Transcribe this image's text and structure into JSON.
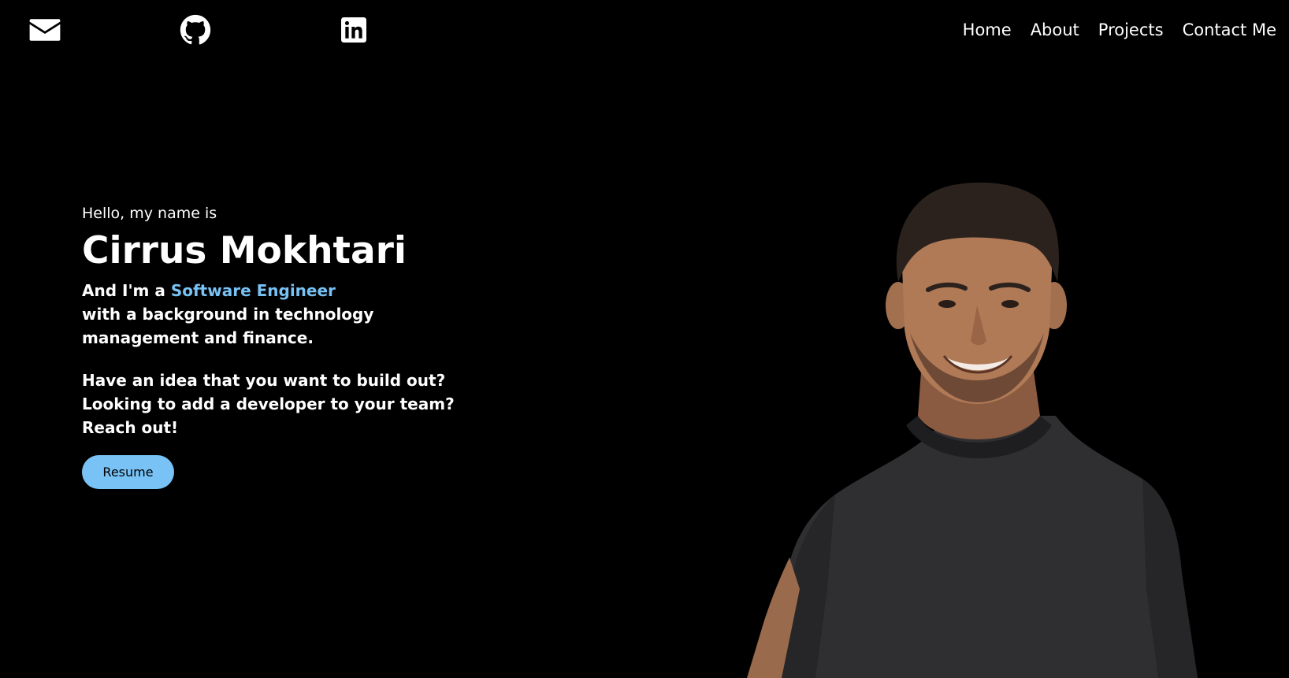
{
  "social": {
    "email_icon": "envelope-icon",
    "github_icon": "github-icon",
    "linkedin_icon": "linkedin-icon"
  },
  "nav": {
    "items": [
      {
        "label": "Home"
      },
      {
        "label": "About"
      },
      {
        "label": "Projects"
      },
      {
        "label": "Contact Me"
      }
    ]
  },
  "hero": {
    "greeting": "Hello, my name is",
    "name": "Cirrus Mokhtari",
    "role_prefix": "And I'm a ",
    "role_highlight": "Software Engineer",
    "role_line2": "with a background in technology",
    "role_line3": "management and finance.",
    "pitch_line1": "Have an idea that you want to build out?",
    "pitch_line2": "Looking to add a developer to your team?",
    "pitch_line3": "Reach out!",
    "resume_label": "Resume"
  },
  "colors": {
    "background": "#000000",
    "text": "#ffffff",
    "accent": "#78c2f5"
  }
}
